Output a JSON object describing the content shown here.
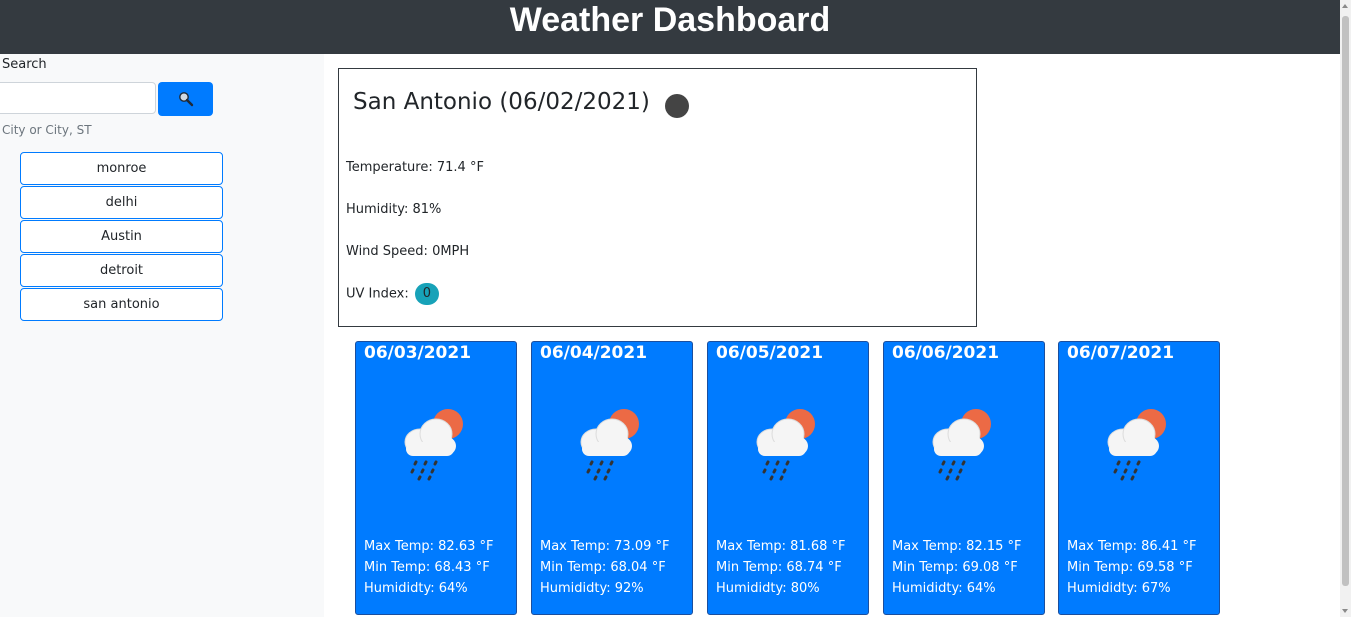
{
  "header": {
    "title": "Weather Dashboard"
  },
  "sidebar": {
    "search_label": "Search",
    "search_value": "",
    "search_button_icon": "search-icon",
    "hint": "City or City, ST",
    "history": [
      "monroe",
      "delhi",
      "Austin",
      "detroit",
      "san antonio"
    ]
  },
  "current": {
    "title": "San Antonio (06/02/2021)",
    "icon": "weather-icon",
    "temperature": "Temperature: 71.4 °F",
    "humidity": "Humidity: 81%",
    "wind": "Wind Speed: 0MPH",
    "uv_label": "UV Index:",
    "uv_value": "0",
    "uv_color": "#17a2b8"
  },
  "forecast": [
    {
      "date": "06/03/2021",
      "icon": "rain-cloud-sun-icon",
      "max": "Max Temp: 82.63 °F",
      "min": "Min Temp: 68.43 °F",
      "humidity": "Humididty: 64%"
    },
    {
      "date": "06/04/2021",
      "icon": "rain-cloud-sun-icon",
      "max": "Max Temp: 73.09 °F",
      "min": "Min Temp: 68.04 °F",
      "humidity": "Humididty: 92%"
    },
    {
      "date": "06/05/2021",
      "icon": "rain-cloud-sun-icon",
      "max": "Max Temp: 81.68 °F",
      "min": "Min Temp: 68.74 °F",
      "humidity": "Humididty: 80%"
    },
    {
      "date": "06/06/2021",
      "icon": "rain-cloud-sun-icon",
      "max": "Max Temp: 82.15 °F",
      "min": "Min Temp: 69.08 °F",
      "humidity": "Humididty: 64%"
    },
    {
      "date": "06/07/2021",
      "icon": "rain-cloud-sun-icon",
      "max": "Max Temp: 86.41 °F",
      "min": "Min Temp: 69.58 °F",
      "humidity": "Humididty: 67%"
    }
  ],
  "colors": {
    "header": "#343a40",
    "primary": "#007bff",
    "sidebar": "#f8f9fa"
  }
}
